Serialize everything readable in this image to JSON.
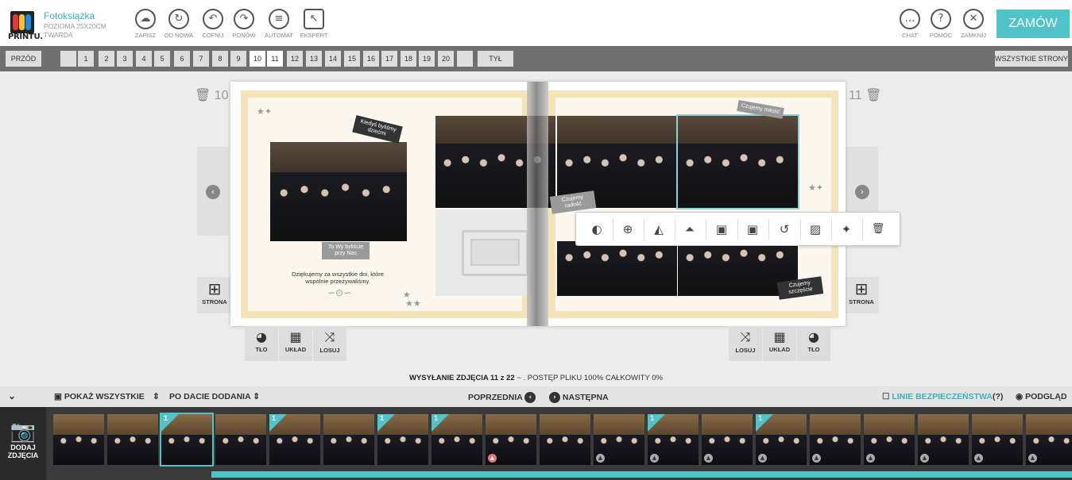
{
  "header": {
    "logo_text": "PRINTU.",
    "product_title": "Fotoksiążka",
    "product_size": "POZIOMA 25X20CM",
    "product_cover": "TWARDA",
    "tools": [
      {
        "label": "ZAPISZ",
        "icon": "cloud-upload-icon",
        "glyph": "☁"
      },
      {
        "label": "OD NOWA",
        "icon": "refresh-icon",
        "glyph": "↻"
      },
      {
        "label": "COFNIJ",
        "icon": "undo-icon",
        "glyph": "↶"
      },
      {
        "label": "PONÓW",
        "icon": "redo-icon",
        "glyph": "↷"
      },
      {
        "label": "AUTOMAT",
        "icon": "layers-icon",
        "glyph": "≡"
      },
      {
        "label": "EKSPERT",
        "icon": "cursor-icon",
        "glyph": "↖"
      }
    ],
    "right_tools": [
      {
        "label": "CHAT",
        "icon": "chat-icon",
        "glyph": "…"
      },
      {
        "label": "POMOC",
        "icon": "help-icon",
        "glyph": "?"
      },
      {
        "label": "ZAMKNIJ",
        "icon": "close-icon",
        "glyph": "✕"
      }
    ],
    "order_label": "ZAMÓW"
  },
  "pagebar": {
    "prev_label": "PRZÓD",
    "next_label": "TYŁ",
    "all_pages_label": "WSZYSTKIE STRONY",
    "pages": [
      "",
      "1",
      "2",
      "3",
      "4",
      "5",
      "6",
      "7",
      "8",
      "9",
      "10",
      "11",
      "12",
      "13",
      "14",
      "15",
      "16",
      "17",
      "18",
      "19",
      "20",
      ""
    ],
    "active_pages": [
      "10",
      "11"
    ]
  },
  "spread": {
    "left_page_number": "10",
    "right_page_number": "11",
    "tags": {
      "childhood": "Kiedyś byliśmy dziećmi",
      "you_were": "To Wy byliście przy Nas",
      "love": "Czujemy miłość",
      "joy": "Czujemy radość",
      "happiness": "Czujemy szczęście"
    },
    "caption": "Dziękujemy za wszystkie dni, które wspólnie przeżywaliśmy."
  },
  "side": {
    "page_button": "STRONA"
  },
  "mini_left": [
    {
      "label": "TŁO",
      "icon": "palette-icon",
      "glyph": "◕"
    },
    {
      "label": "UKŁAD",
      "icon": "grid-icon",
      "glyph": "▦"
    },
    {
      "label": "LOSUJ",
      "icon": "shuffle-icon",
      "glyph": "⤨"
    }
  ],
  "mini_right": [
    {
      "label": "LOSUJ",
      "icon": "shuffle-icon",
      "glyph": "⤨"
    },
    {
      "label": "UKŁAD",
      "icon": "grid-icon",
      "glyph": "▦"
    },
    {
      "label": "TŁO",
      "icon": "palette-icon",
      "glyph": "◕"
    }
  ],
  "floatbar": [
    {
      "name": "contrast-icon",
      "glyph": "◐"
    },
    {
      "name": "zoom-in-icon",
      "glyph": "⊕"
    },
    {
      "name": "flip-horizontal-icon",
      "glyph": "◭"
    },
    {
      "name": "flip-vertical-icon",
      "glyph": "⏶"
    },
    {
      "name": "fit-icon",
      "glyph": "▣"
    },
    {
      "name": "fill-icon",
      "glyph": "▣"
    },
    {
      "name": "rotate-icon",
      "glyph": "↺"
    },
    {
      "name": "replace-image-icon",
      "glyph": "▨"
    },
    {
      "name": "magic-wand-icon",
      "glyph": "✦"
    },
    {
      "name": "trash-icon",
      "glyph": "🗑"
    }
  ],
  "upload": {
    "status": "WYSYŁANIE ZDJĘCIA 11 z 22",
    "progress": "~ . POSTĘP PLIKU 100% CAŁKOWITY 0%"
  },
  "toolbar": {
    "show_all": "POKAŻ WSZYSTKIE",
    "sort_by": "PO DACIE DODANIA",
    "previous": "POPRZEDNIA",
    "next": "NASTĘPNA",
    "safety_lines": "LINIE BEZPIECZEŃSTWA",
    "help": "(?)",
    "preview": "PODGLĄD"
  },
  "strip": {
    "add_label_1": "DODAJ",
    "add_label_2": "ZDJĘCIA",
    "count_label": "1",
    "thumbs": [
      {
        "count": false,
        "up": "none",
        "sel": false
      },
      {
        "count": false,
        "up": "none",
        "sel": false
      },
      {
        "count": true,
        "up": "none",
        "sel": true
      },
      {
        "count": false,
        "up": "none",
        "sel": false
      },
      {
        "count": true,
        "up": "none",
        "sel": false
      },
      {
        "count": false,
        "up": "none",
        "sel": false
      },
      {
        "count": true,
        "up": "none",
        "sel": false
      },
      {
        "count": true,
        "up": "none",
        "sel": false
      },
      {
        "count": false,
        "up": "red",
        "sel": false
      },
      {
        "count": false,
        "up": "none",
        "sel": false
      },
      {
        "count": false,
        "up": "grey",
        "sel": false
      },
      {
        "count": true,
        "up": "grey",
        "sel": false
      },
      {
        "count": false,
        "up": "grey",
        "sel": false
      },
      {
        "count": true,
        "up": "grey",
        "sel": false
      },
      {
        "count": false,
        "up": "grey",
        "sel": false
      },
      {
        "count": false,
        "up": "grey",
        "sel": false
      },
      {
        "count": false,
        "up": "grey",
        "sel": false
      },
      {
        "count": false,
        "up": "grey",
        "sel": false
      },
      {
        "count": false,
        "up": "grey",
        "sel": false
      }
    ]
  },
  "colors": {
    "accent": "#4fc3c8",
    "frame": "#f5e4b8",
    "pagebar": "#707070"
  }
}
